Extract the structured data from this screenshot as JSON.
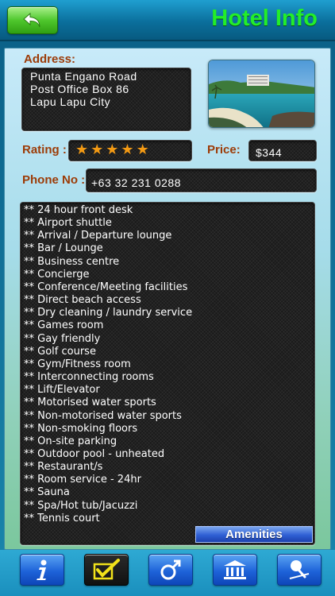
{
  "header": {
    "title": "Hotel Info",
    "back_icon": "back-arrow-icon"
  },
  "address": {
    "label": "Address:",
    "lines": [
      "Punta Engano Road",
      "Post Office Box 86",
      "Lapu Lapu City"
    ]
  },
  "rating": {
    "label": "Rating :",
    "stars": 5,
    "max": 5
  },
  "price": {
    "label": "Price:",
    "value": "$344"
  },
  "phone": {
    "label": "Phone No :",
    "value": "+63 32 231 0288"
  },
  "amenities": {
    "tab_label": "Amenities",
    "items": [
      "** 24 hour front desk",
      "** Airport shuttle",
      "** Arrival / Departure lounge",
      "** Bar / Lounge",
      "** Business centre",
      "** Concierge",
      "** Conference/Meeting facilities",
      "** Direct beach access",
      "** Dry cleaning / laundry service",
      "** Games room",
      "** Gay friendly",
      "** Golf course",
      "** Gym/Fitness room",
      "** Interconnecting rooms",
      "** Lift/Elevator",
      "** Motorised water sports",
      "** Non-motorised water sports",
      "** Non-smoking floors",
      "** On-site parking",
      "** Outdoor pool - unheated",
      "** Restaurant/s",
      "** Room service - 24hr",
      "** Sauna",
      "** Spa/Hot tub/Jacuzzi",
      "** Tennis court"
    ]
  },
  "tabbar": {
    "tabs": [
      {
        "icon": "info-icon",
        "active": false
      },
      {
        "icon": "checkmark-icon",
        "active": true
      },
      {
        "icon": "gender-male-icon",
        "active": false
      },
      {
        "icon": "bank-building-icon",
        "active": false
      },
      {
        "icon": "map-pin-icon",
        "active": false
      }
    ]
  },
  "colors": {
    "title": "#23ee2a",
    "label": "#9c3b07",
    "star": "#f39a14",
    "tab_blue": "#1e63d9"
  }
}
